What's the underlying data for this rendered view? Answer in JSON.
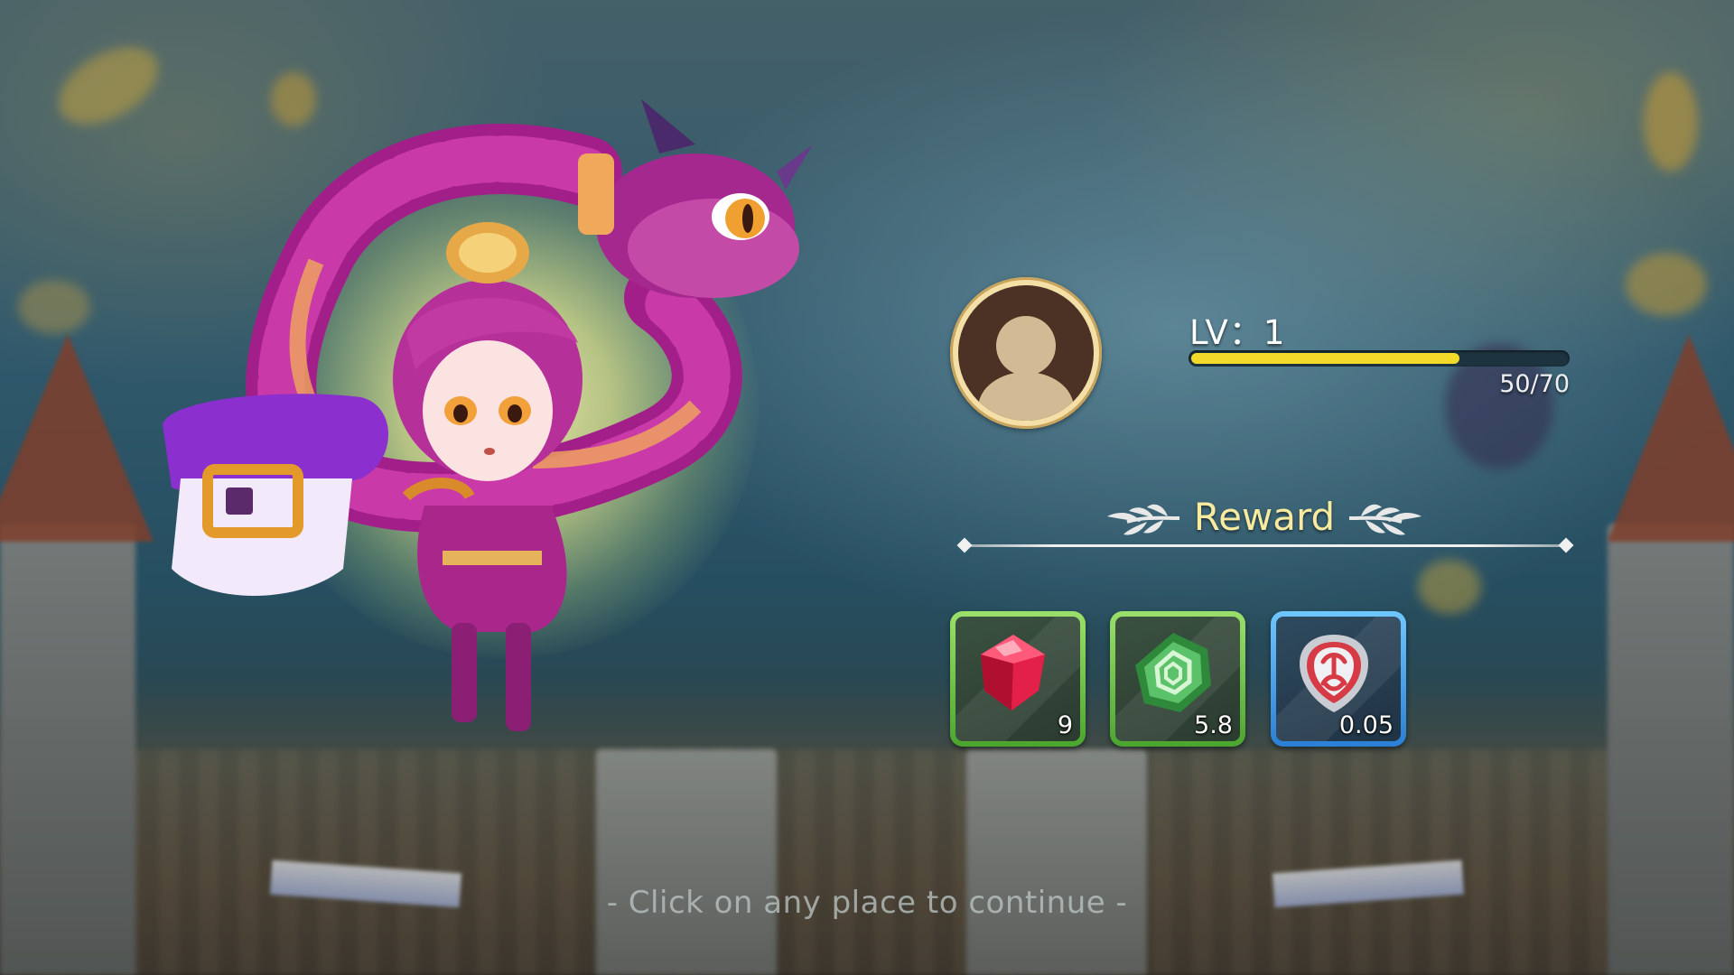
{
  "player": {
    "level_label": "LV：1",
    "xp_text": "50/70",
    "xp_current": 50,
    "xp_max": 70,
    "xp_progress": 0.714
  },
  "reward": {
    "title": "Reward",
    "items": [
      {
        "icon": "red-gem-icon",
        "quantity": "9",
        "frame_color": "#5fbf3c"
      },
      {
        "icon": "green-rune-icon",
        "quantity": "5.8",
        "frame_color": "#5fbf3c"
      },
      {
        "icon": "silver-shield-emblem-icon",
        "quantity": "0.05",
        "frame_color": "#3a9ae8"
      }
    ]
  },
  "hint": {
    "continue_text": "- Click on any place to continue -"
  },
  "colors": {
    "xp_fill": "#f2d92a",
    "reward_title": "#f8ea9e",
    "avatar_ring": "#f4dfa6"
  }
}
